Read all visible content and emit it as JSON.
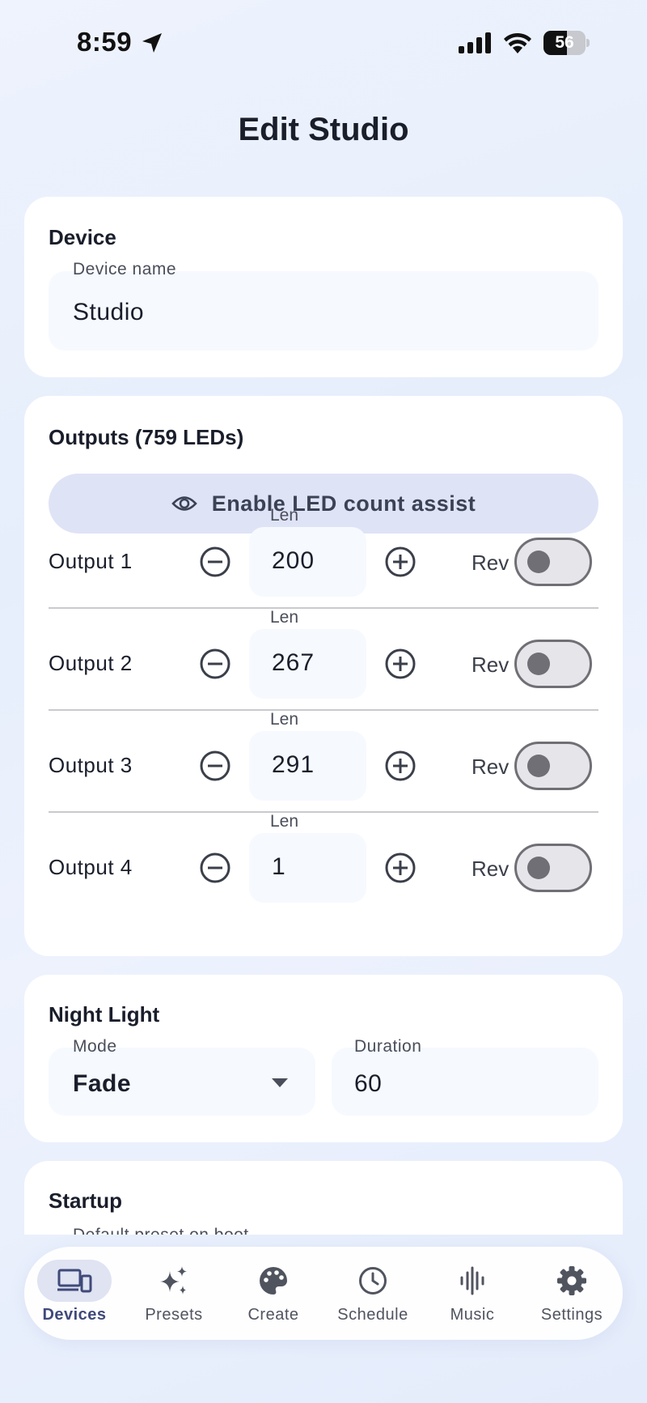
{
  "status_bar": {
    "time": "8:59",
    "battery_level": "56",
    "battery_fraction": 0.56
  },
  "page": {
    "title": "Edit Studio"
  },
  "device_card": {
    "title": "Device",
    "name_label": "Device name",
    "name_value": "Studio"
  },
  "outputs_card": {
    "title": "Outputs (759 LEDs)",
    "assist_button": "Enable LED count assist",
    "len_label": "Len",
    "rev_label": "Rev",
    "outputs": [
      {
        "label": "Output 1",
        "length": "200",
        "reversed": false
      },
      {
        "label": "Output 2",
        "length": "267",
        "reversed": false
      },
      {
        "label": "Output 3",
        "length": "291",
        "reversed": false
      },
      {
        "label": "Output 4",
        "length": "1",
        "reversed": false
      }
    ]
  },
  "night_light_card": {
    "title": "Night Light",
    "mode_label": "Mode",
    "mode_value": "Fade",
    "duration_label": "Duration",
    "duration_value": "60"
  },
  "startup_card": {
    "title": "Startup",
    "field_label": "Default preset on boot"
  },
  "bottom_nav": {
    "items": [
      {
        "label": "Devices",
        "icon": "devices-icon",
        "active": true
      },
      {
        "label": "Presets",
        "icon": "sparkles-icon",
        "active": false
      },
      {
        "label": "Create",
        "icon": "palette-icon",
        "active": false
      },
      {
        "label": "Schedule",
        "icon": "clock-icon",
        "active": false
      },
      {
        "label": "Music",
        "icon": "waveform-icon",
        "active": false
      },
      {
        "label": "Settings",
        "icon": "gear-icon",
        "active": false
      }
    ]
  },
  "colors": {
    "accent": "#3f4a7a",
    "assist_button_bg": "#dfe3f6",
    "field_bg": "#f6f9fe",
    "toggle_off": "#6f6f75"
  }
}
